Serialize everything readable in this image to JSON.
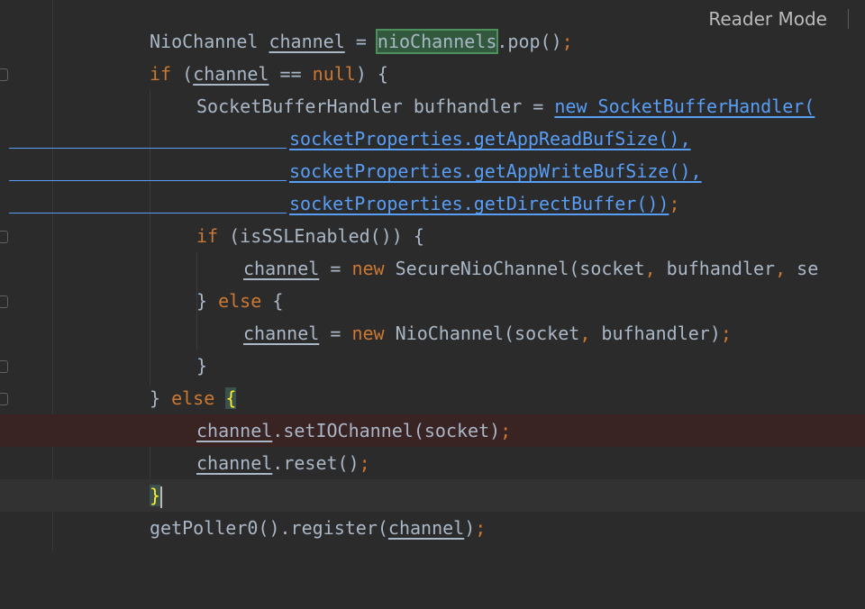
{
  "reader_mode": {
    "label": "Reader Mode"
  },
  "code": {
    "l1": {
      "type": "NioChannel",
      "var": "channel",
      "eq": "=",
      "sel": "nioChannels",
      "rest": ".pop()",
      "semi": ";"
    },
    "l2": {
      "kw": "if",
      "open": "(",
      "var": "channel",
      "op": "==",
      "null": "null",
      "close": ") {"
    },
    "l3": {
      "type": "SocketBufferHandler bufhandler =",
      "new": "new",
      "ctor": "SocketBufferHandler("
    },
    "l4": {
      "call": "socketProperties.getAppReadBufSize()",
      "comma": ","
    },
    "l5": {
      "call": "socketProperties.getAppWriteBufSize()",
      "comma": ","
    },
    "l6": {
      "call": "socketProperties.getDirectBuffer())",
      "semi": ";"
    },
    "l7": {
      "kw": "if",
      "rest": "(isSSLEnabled()) {"
    },
    "l8": {
      "var": "channel",
      "eq": "=",
      "new": "new",
      "rest1": "SecureNioChannel(socket",
      "c1": ",",
      "rest2": "bufhandler",
      "c2": ",",
      "rest3": "se"
    },
    "l9": {
      "close": "}",
      "kw": "else",
      "open": "{"
    },
    "l10": {
      "var": "channel",
      "eq": "=",
      "new": "new",
      "rest1": "NioChannel(socket",
      "c1": ",",
      "rest2": "bufhandler)",
      "semi": ";"
    },
    "l11": {
      "close": "}"
    },
    "l12": {
      "close": "}",
      "kw": "else",
      "open": "{"
    },
    "l13": {
      "var": "channel",
      "rest": ".setIOChannel(socket)",
      "semi": ";"
    },
    "l14": {
      "var": "channel",
      "rest": ".reset()",
      "semi": ";"
    },
    "l15": {
      "close": "}"
    },
    "l16": {
      "rest1": "getPoller0().register(",
      "var": "channel",
      "rest2": ")",
      "semi": ";"
    }
  }
}
